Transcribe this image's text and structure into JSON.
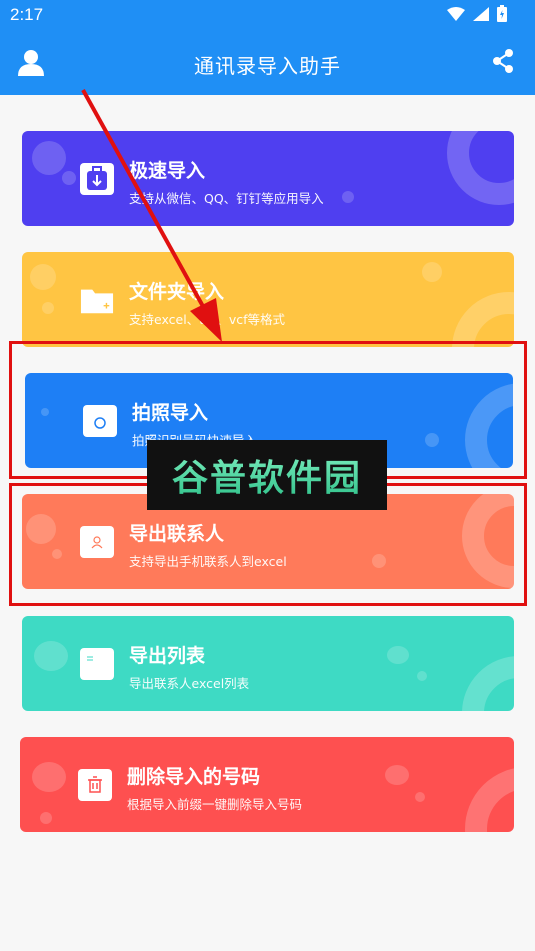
{
  "status_bar": {
    "time": "2:17",
    "icons": [
      "wifi-icon",
      "signal-icon",
      "battery-icon"
    ]
  },
  "app_bar": {
    "title": "通讯录导入助手",
    "left_icon": "user-icon",
    "right_icon": "share-icon"
  },
  "cards": [
    {
      "title": "极速导入",
      "subtitle": "支持从微信、QQ、钉钉等应用导入",
      "color": "#4f3ff0",
      "icon": "import-icon"
    },
    {
      "title": "文件夹导入",
      "subtitle": "支持excel、txt、vcf等格式",
      "color": "#ffc543",
      "icon": "folder-icon"
    },
    {
      "title": "拍照导入",
      "subtitle": "拍照识别号码快速导入",
      "color": "#1e7ff5",
      "icon": "camera-icon"
    },
    {
      "title": "导出联系人",
      "subtitle": "支持导出手机联系人到excel",
      "color": "#ff7a5a",
      "icon": "contact-card-icon"
    },
    {
      "title": "导出列表",
      "subtitle": "导出联系人excel列表",
      "color": "#3edac4",
      "icon": "list-icon"
    },
    {
      "title": "删除导入的号码",
      "subtitle": "根据导入前缀一键删除导入号码",
      "color": "#fe5050",
      "icon": "trash-icon"
    }
  ],
  "watermark": {
    "text": "谷普软件园"
  },
  "annotation_colors": {
    "highlight": "#e01010",
    "arrow": "#e01010"
  }
}
